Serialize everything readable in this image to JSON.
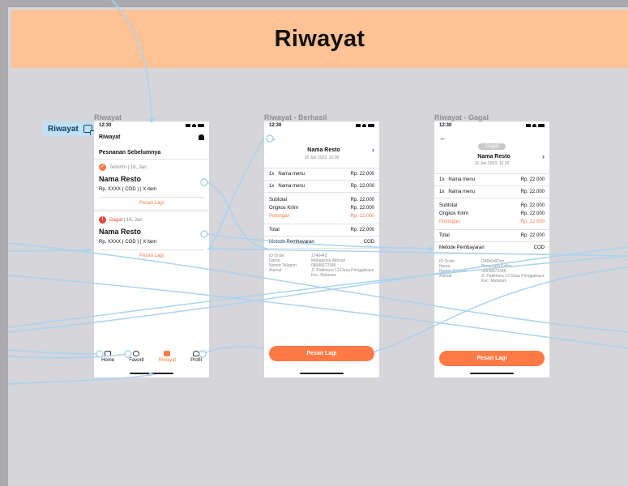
{
  "header": {
    "title": "Riwayat"
  },
  "tag": {
    "label": "Riwayat"
  },
  "frames": {
    "list": {
      "title": "Riwayat"
    },
    "success": {
      "title": "Riwayat - Berhasil"
    },
    "failed": {
      "title": "Riwayat - Gagal"
    }
  },
  "status_time": "12:30",
  "list": {
    "app_title": "Riwayat",
    "section": "Pesnanan Sebelumnya",
    "orders": [
      {
        "status": "Terkirim",
        "date": "16, Jan",
        "resto": "Nama Resto",
        "price": "Rp. XXXX ( COD )",
        "items": "X item",
        "action": "Pesan Lagi"
      },
      {
        "status": "Gagal",
        "date": "16, Jan",
        "resto": "Nama Resto",
        "price": "Rp. XXXX ( COD )",
        "items": "X item",
        "action": "Pesan Lagi"
      }
    ],
    "nav": [
      "Home",
      "Favorit",
      "Riwayat",
      "Profil"
    ]
  },
  "success": {
    "resto": "Nama Resto",
    "datetime": "16 Jan 2023, 10.00",
    "menu": [
      {
        "qty": "1x",
        "name": "Nama menu",
        "price": "Rp. 22.000"
      },
      {
        "qty": "1x",
        "name": "Nama menu",
        "price": "Rp. 22.000"
      }
    ],
    "subtotal_label": "Subtotal",
    "subtotal": "Rp. 22.000",
    "ongkir_label": "Ongkos Kirim",
    "ongkir": "Rp. 22.000",
    "potongan_label": "Potongan",
    "potongan": "-Rp. 22.000",
    "total_label": "Total",
    "total": "Rp. 22.000",
    "method_label": "Metode Pembayaran",
    "method": "COD",
    "info": [
      {
        "k": "ID Order",
        "v": "1746443"
      },
      {
        "k": "Nama",
        "v": "Mahadewa Akhsan"
      },
      {
        "k": "Nomor Telepon",
        "v": "08948672346"
      },
      {
        "k": "Alamat",
        "v": "Jl. Pattimura 12 Desa Pringgabaya Kec. Mataram"
      }
    ],
    "button": "Pesan Lagi"
  },
  "failed": {
    "badge": "Gagal",
    "resto": "Nama Resto",
    "datetime": "16 Jan 2023, 10.00",
    "menu": [
      {
        "qty": "1x",
        "name": "Nama menu",
        "price": "Rp. 22.000"
      },
      {
        "qty": "1x",
        "name": "Nama menu",
        "price": "Rp. 22.000"
      }
    ],
    "subtotal_label": "Subtotal",
    "subtotal": "Rp. 22.000",
    "ongkir_label": "Ongkos Kirim",
    "ongkir": "Rp. 22.000",
    "potongan_label": "Potongan",
    "potongan": "-Rp. 22.000",
    "total_label": "Total",
    "total": "Rp. 22.000",
    "method_label": "Metode Pembayaran",
    "method": "COD",
    "info": [
      {
        "k": "ID Order",
        "v": "D4RKtr6Dan"
      },
      {
        "k": "Nama",
        "v": "Bimantara Kafira"
      },
      {
        "k": "Nomor Telepon",
        "v": "08948672346"
      },
      {
        "k": "Alamat",
        "v": "Jl. Pattimura 12 Desa Pringgabaya Kec. Mataram"
      }
    ],
    "button": "Pesan Lagi"
  },
  "colors": {
    "accent": "#ff7a45",
    "header": "#ffc295",
    "wire": "#a9d4f2",
    "canvas": "#d5d5da"
  }
}
